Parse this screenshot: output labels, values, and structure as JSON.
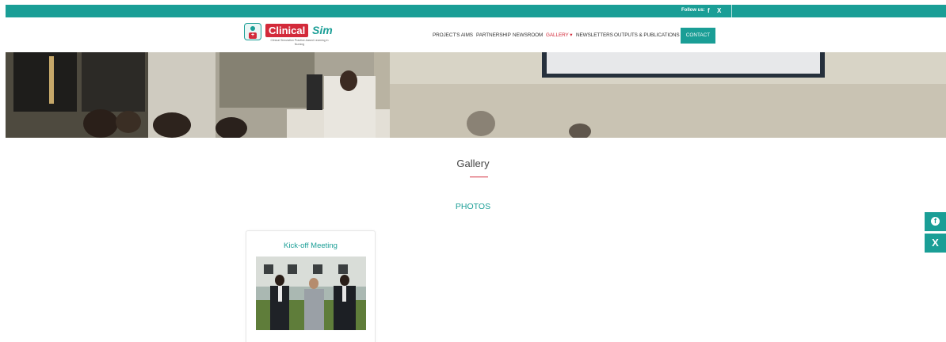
{
  "topbar": {
    "follow_label": "Follow us:",
    "facebook_glyph": "f",
    "x_glyph": "X"
  },
  "logo": {
    "brand_main": "Clinical",
    "brand_accent": "Sim",
    "tagline": "Clinical Simulation Practice-based Learning in Nursing"
  },
  "nav": {
    "items": [
      {
        "label": "PROJECT'S AIMS"
      },
      {
        "label": "PARTNERSHIP"
      },
      {
        "label": "NEWSROOM"
      },
      {
        "label": "GALLERY ▾"
      },
      {
        "label": "NEWSLETTERS"
      },
      {
        "label": "OUTPUTS & PUBLICATIONS"
      }
    ],
    "active_index": 3,
    "contact_label": "CONTACT"
  },
  "banner": {
    "icon": "hero-photo-conference-room"
  },
  "main": {
    "title": "Gallery",
    "section_heading": "PHOTOS"
  },
  "album": {
    "title": "Kick-off Meeting",
    "icon": "album-photo-group"
  },
  "side_social": {
    "facebook_icon": "facebook-icon",
    "x_label": "X"
  },
  "colors": {
    "accent_teal": "#1a9e96",
    "brand_red": "#d32a3a"
  }
}
